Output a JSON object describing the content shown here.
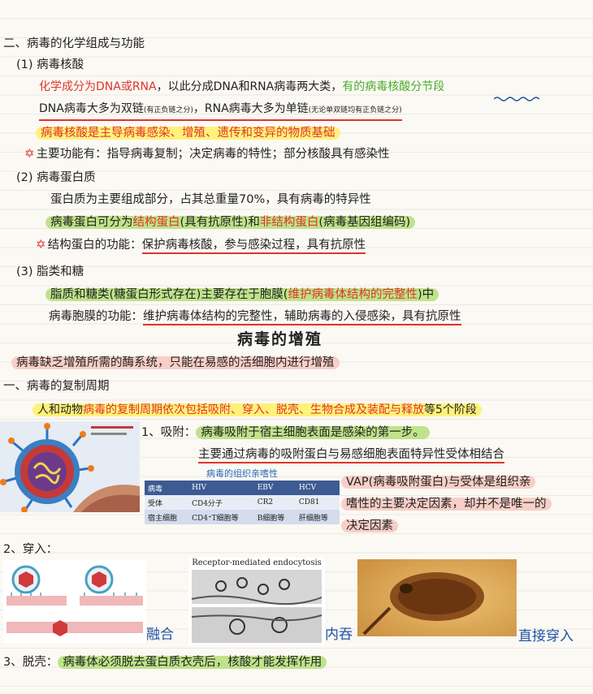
{
  "section2": {
    "heading": "二、病毒的化学组成与功能",
    "nucleic": {
      "heading": "(1) 病毒核酸",
      "line1_red": "化学成分为DNA或RNA",
      "line1_mid": "，以此分成DNA和RNA病毒两大类，",
      "line1_green": "有的病毒核酸分节段",
      "line2_a": "DNA病毒大多为双链",
      "line2_a_small": "(有正负链之分)",
      "line2_b": "，RNA病毒大多为单链",
      "line2_b_small": "(无论单双链均有正负链之分)",
      "line3": "病毒核酸是主导病毒感染、增殖、遗传和变异的物质基础",
      "line4": "主要功能有：指导病毒复制；决定病毒的特性；部分核酸具有感染性"
    },
    "protein": {
      "heading": "(2) 病毒蛋白质",
      "line1": "蛋白质为主要组成部分，占其总重量70%，具有病毒的特异性",
      "line2_a": "病毒蛋白可分为",
      "line2_b": "结构蛋白",
      "line2_c": "(具有抗原性)和",
      "line2_d": "非结构蛋白",
      "line2_e": "(病毒基因组编码)",
      "line3_a": "结构蛋白的功能：",
      "line3_b": "保护病毒核酸，参与感染过程，具有抗原性"
    },
    "lipid": {
      "heading": "(3) 脂类和糖",
      "line1_a": "脂质和糖类(糖蛋白形式存在)主要存在于胞膜(",
      "line1_b": "维护病毒体结构的完整性",
      "line1_c": ")中",
      "line2_a": "病毒胞膜的功能：",
      "line2_b": "维护病毒体结构的完整性，辅助病毒的入侵感染，具有抗原性"
    }
  },
  "proliferation": {
    "title": "病毒的增殖",
    "intro": "病毒缺乏增殖所需的酶系统，只能在易感的活细胞内进行增殖",
    "cycle_heading": "一、病毒的复制周期",
    "cycle_line_a": "人和动物",
    "cycle_line_b": "病毒的复制周期依次包括吸附、穿入、脱壳、生物合成及装配与释放",
    "cycle_line_c": "等5个阶段"
  },
  "adsorption": {
    "heading": "1、吸附：",
    "line1": "病毒吸附于宿主细胞表面是感染的第一步。",
    "line2": "主要通过病毒的吸附蛋白与易感细胞表面特异性受体相结合",
    "vap_line1": "VAP(病毒吸附蛋白)与受体是组织亲",
    "vap_line2": "嗜性的主要决定因素，却并不是唯一的",
    "vap_line3": "决定因素",
    "table": {
      "caption": "病毒的组织亲嗜性",
      "header": [
        "病毒",
        "HIV",
        "EBV",
        "HCV"
      ],
      "rows": [
        [
          "受体",
          "CD4分子",
          "CR2",
          "CD81"
        ],
        [
          "宿主细胞",
          "CD4⁺T细胞等",
          "B细胞等",
          "肝细胞等"
        ]
      ]
    }
  },
  "penetration": {
    "heading": "2、穿入：",
    "em_caption": "Receptor-mediated endocytosis",
    "label_fusion": "融合",
    "label_endocytosis": "内吞",
    "label_direct": "直接穿入"
  },
  "uncoating": {
    "heading": "3、脱壳：",
    "line": "病毒体必须脱去蛋白质衣壳后，核酸才能发挥作用"
  },
  "colors": {
    "highlight_yellow": "#fff27a",
    "highlight_green": "#bfe38a",
    "highlight_pink": "#f8cfc6",
    "red_ink": "#e0342a",
    "green_ink": "#4caa2e",
    "blue_ink": "#2153a6"
  }
}
